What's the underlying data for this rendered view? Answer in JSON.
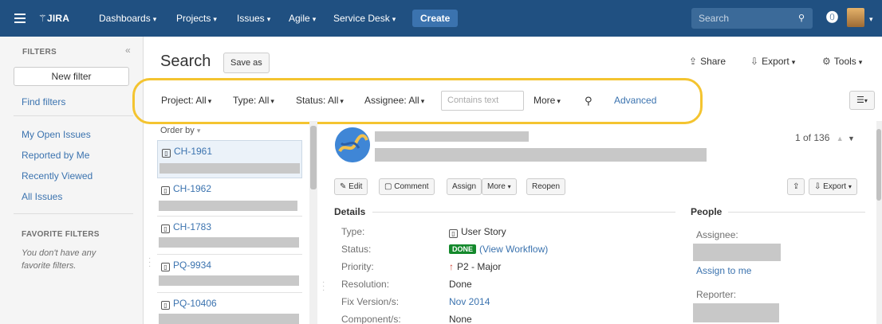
{
  "nav": {
    "logo": "JIRA",
    "items": [
      {
        "label": "Dashboards"
      },
      {
        "label": "Projects"
      },
      {
        "label": "Issues"
      },
      {
        "label": "Agile"
      },
      {
        "label": "Service Desk"
      }
    ],
    "create_label": "Create",
    "search_placeholder": "Search"
  },
  "sidebar": {
    "title": "FILTERS",
    "collapse": "«",
    "new_filter": "New filter",
    "find_filters": "Find filters",
    "links": [
      "My Open Issues",
      "Reported by Me",
      "Recently Viewed",
      "All Issues"
    ],
    "favorites_title": "FAVORITE FILTERS",
    "favorites_empty": "You don't have any favorite filters."
  },
  "header": {
    "title": "Search",
    "save_as": "Save as",
    "share": "Share",
    "export": "Export",
    "tools": "Tools"
  },
  "filters": {
    "project": "Project: All",
    "type": "Type: All",
    "status": "Status: All",
    "assignee": "Assignee: All",
    "contains_placeholder": "Contains text",
    "more": "More",
    "advanced": "Advanced"
  },
  "list": {
    "order_by": "Order by",
    "issues": [
      {
        "key": "CH-1961",
        "type_icon": "story-icon"
      },
      {
        "key": "CH-1962",
        "type_icon": "story-icon"
      },
      {
        "key": "CH-1783",
        "type_icon": "story-icon"
      },
      {
        "key": "PQ-9934",
        "type_icon": "story-icon"
      },
      {
        "key": "PQ-10406",
        "type_icon": "story-icon"
      }
    ]
  },
  "detail": {
    "pager": "1 of 136",
    "buttons": {
      "edit": "Edit",
      "comment": "Comment",
      "assign": "Assign",
      "more": "More",
      "reopen": "Reopen",
      "export": "Export"
    },
    "details_title": "Details",
    "people_title": "People",
    "fields": [
      {
        "label": "Type:",
        "value": "User Story"
      },
      {
        "label": "Status:",
        "value": "(View Workflow)",
        "badge": "DONE"
      },
      {
        "label": "Priority:",
        "value": "P2 - Major"
      },
      {
        "label": "Resolution:",
        "value": "Done"
      },
      {
        "label": "Fix Version/s:",
        "value": "Nov 2014"
      },
      {
        "label": "Component/s:",
        "value": "None"
      }
    ],
    "people": {
      "assignee_label": "Assignee:",
      "assign_to_me": "Assign to me",
      "reporter_label": "Reporter:"
    }
  },
  "colors": {
    "nav_bg": "#205081",
    "link": "#3b73af",
    "highlight": "#f4c430",
    "done": "#14892c"
  }
}
